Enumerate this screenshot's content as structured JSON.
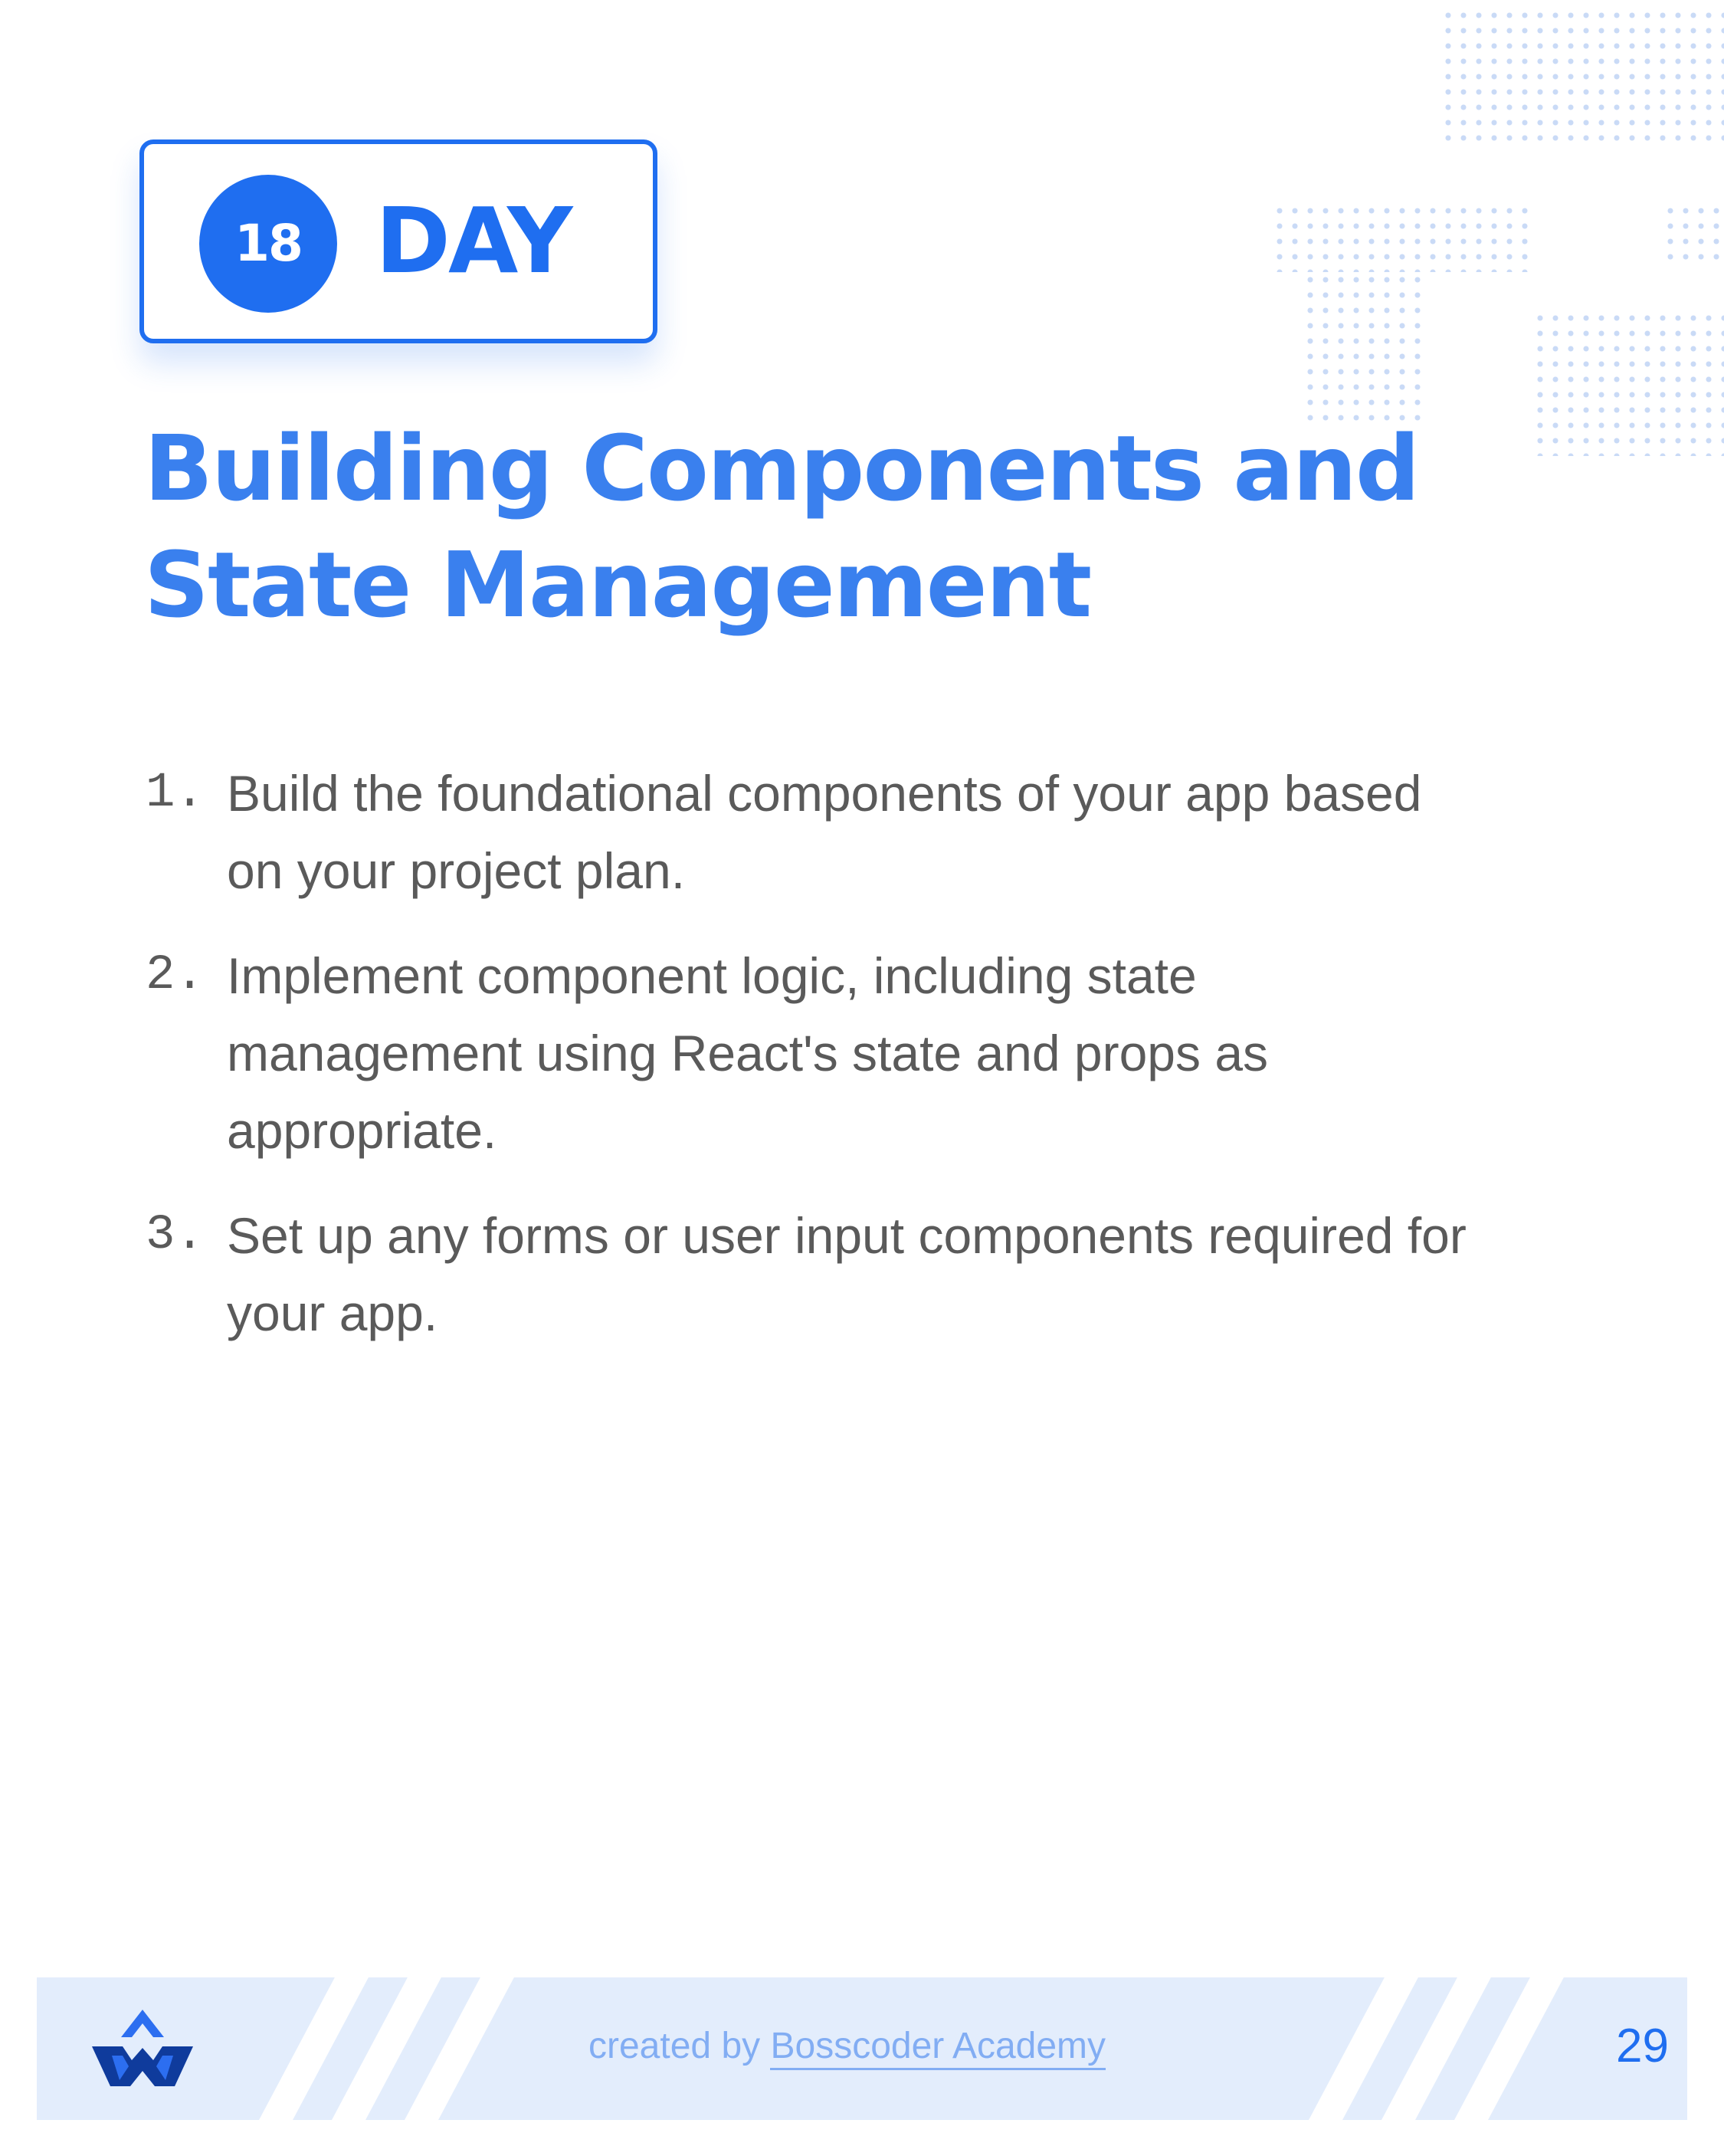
{
  "badge": {
    "number": "18",
    "label": "DAY"
  },
  "title": {
    "line1": "Building Components and",
    "line2": "State Management"
  },
  "steps": [
    {
      "number": "1.",
      "lines": [
        "Build the foundational components of your app based",
        "on your project plan."
      ]
    },
    {
      "number": "2.",
      "lines": [
        "Implement component logic, including state",
        "management using React's state and props as",
        "appropriate."
      ]
    },
    {
      "number": "3.",
      "lines": [
        "Set up any forms or user input components required for",
        "your app."
      ]
    }
  ],
  "footer": {
    "credit_prefix": "created by",
    "brand": "Bosscoder Academy",
    "page_number": "29",
    "logo_icon": "bosscoder-logo"
  },
  "colors": {
    "accent": "#1f6ef0",
    "title": "#3a80ee",
    "body_text": "#5a5a5a",
    "footer_bg": "#e3edfc",
    "footer_text": "#82adf3"
  }
}
